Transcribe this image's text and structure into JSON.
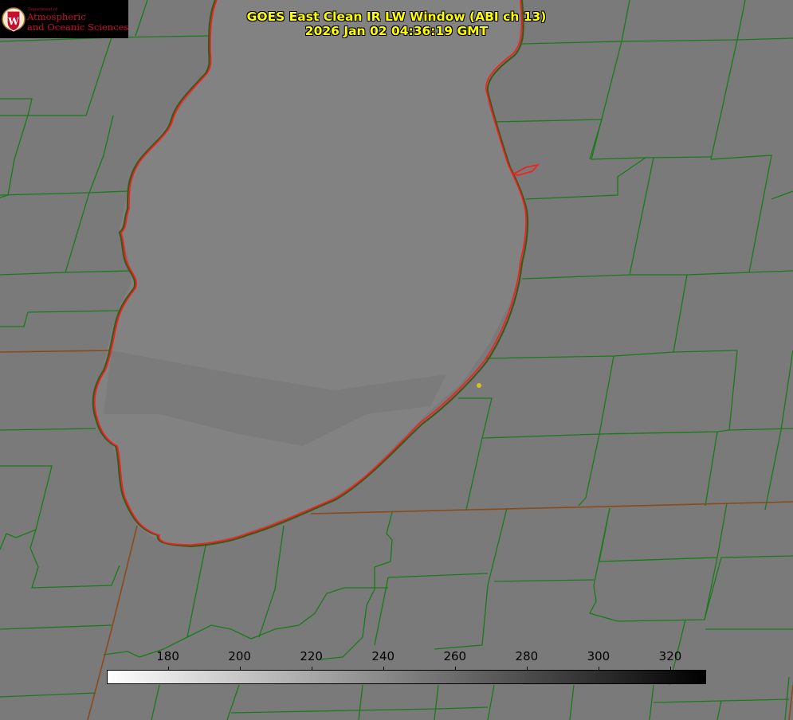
{
  "logo": {
    "department": "Department of",
    "line1": "Atmospheric",
    "line2": "and Oceanic Sciences",
    "seal_icon": "uw-crest-icon",
    "color": "#c8102e"
  },
  "title": {
    "line1": "GOES East Clean IR LW Window (ABI ch 13)",
    "line2": "2026 Jan 02 04:36:19 GMT",
    "color": "#ffff00"
  },
  "colorbar": {
    "ticks": [
      "180",
      "200",
      "220",
      "240",
      "260",
      "280",
      "300",
      "320"
    ],
    "tick_values": [
      180,
      200,
      220,
      240,
      260,
      280,
      300,
      320
    ],
    "range": [
      163,
      330
    ],
    "color_low": "#ffffff",
    "color_high": "#000000"
  },
  "map": {
    "background": "#7a7a7a",
    "lake_fill": "#828282",
    "county_line_color": "#1a7a1a",
    "shoreline_color": "#ff1a1a",
    "marker_color": "#d4c418"
  }
}
